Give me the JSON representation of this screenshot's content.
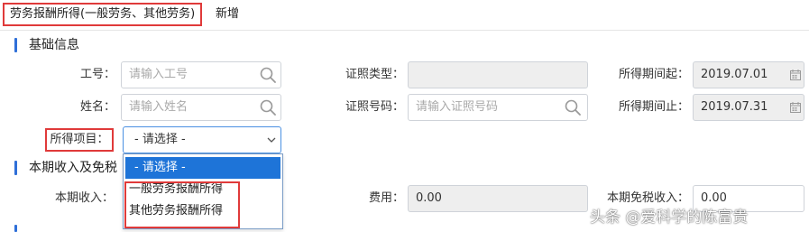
{
  "header": {
    "title_boxed": "劳务报酬所得(一般劳务、其他劳务)",
    "title_suffix": "新增"
  },
  "sections": {
    "basic_info": "基础信息",
    "income_exempt": "本期收入及免税"
  },
  "form": {
    "employee_no": {
      "label": "工号：",
      "placeholder": "请输入工号"
    },
    "name": {
      "label": "姓名：",
      "placeholder": "请输入姓名"
    },
    "id_type": {
      "label": "证照类型：",
      "value": ""
    },
    "id_number": {
      "label": "证照号码：",
      "placeholder": "请输入证照号码"
    },
    "period_start": {
      "label": "所得期间起：",
      "value": "2019.07.01"
    },
    "period_end": {
      "label": "所得期间止：",
      "value": "2019.07.31"
    },
    "income_item": {
      "label": "所得项目：",
      "selected": "- 请选择 -",
      "options": [
        "- 请选择 -",
        "一般劳务报酬所得",
        "其他劳务报酬所得"
      ]
    },
    "current_income": {
      "label": "本期收入："
    },
    "expense": {
      "label": "费用：",
      "value": "0.00"
    },
    "tax_exempt_income": {
      "label": "本期免税收入：",
      "value": "0.00"
    }
  },
  "watermark": "头条 @爱科学的陈富贵",
  "colors": {
    "accent_blue": "#1e74d8",
    "section_bar": "#2f6fd8",
    "highlight_red": "#e03a3a",
    "disabled_bg": "#eeeeee"
  },
  "icons": [
    "search-icon",
    "calendar-icon",
    "chevron-down-icon"
  ]
}
